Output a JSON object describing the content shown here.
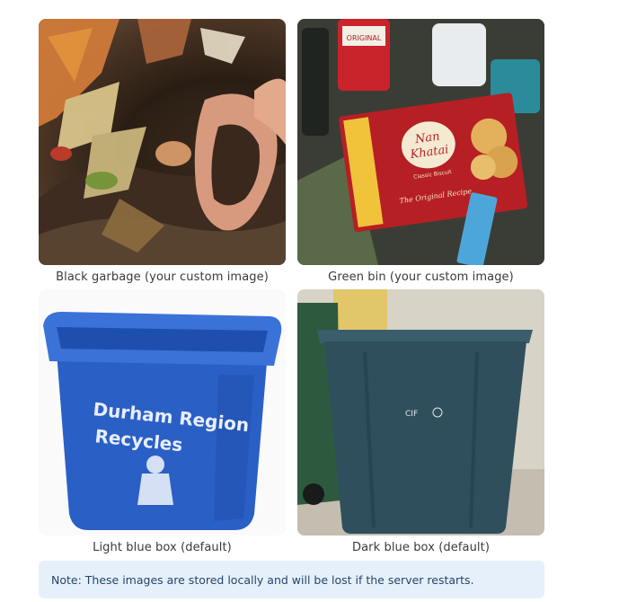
{
  "gallery": {
    "items": [
      {
        "caption": "Black garbage (your custom image)"
      },
      {
        "caption": "Green bin (your custom image)"
      },
      {
        "caption": "Light blue box (default)"
      },
      {
        "caption": "Dark blue box (default)"
      }
    ]
  },
  "images": {
    "snack_box": {
      "brand_line1": "Nan",
      "brand_line2": "Khatai",
      "sub": "Classic Biscuit",
      "tagline": "The Original Recipe",
      "jar_label": "ORIGINAL"
    },
    "light_box": {
      "line1": "Durham Region",
      "line2": "Recycles"
    },
    "dark_box": {
      "label": "CIF"
    }
  },
  "note": {
    "text": "Note: These images are stored locally and will be lost if the server restarts."
  },
  "colors": {
    "note_bg": "#e6f0fb",
    "note_text": "#24466b",
    "light_blue_box": "#2a5fc6",
    "dark_blue_box": "#2f4f5c"
  }
}
